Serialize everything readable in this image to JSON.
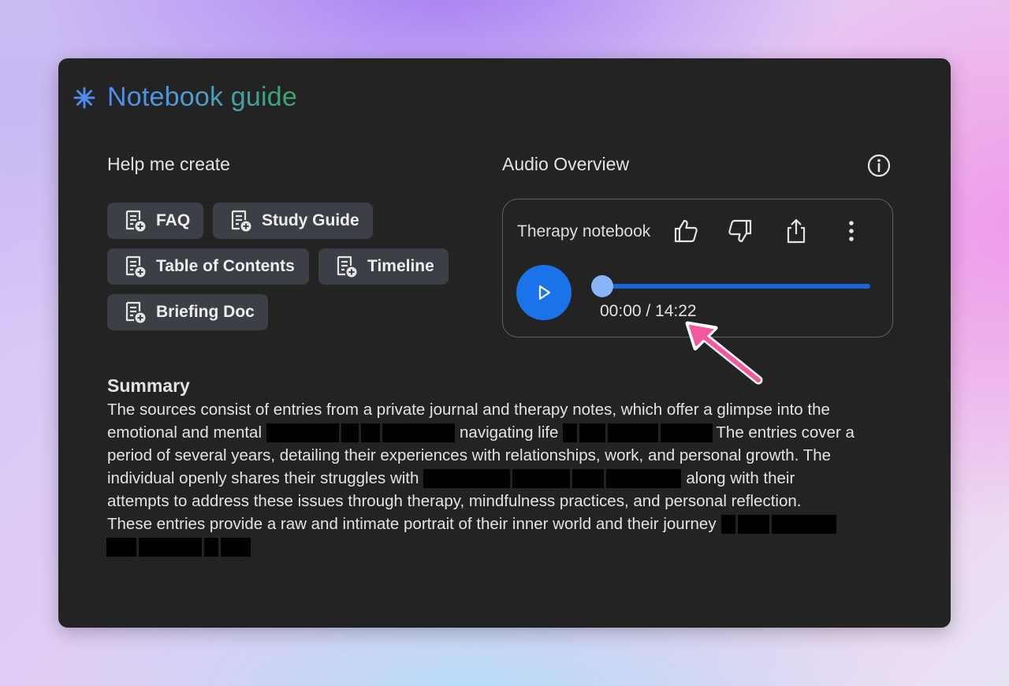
{
  "guide": {
    "title": "Notebook guide",
    "icon": "sparkle-asterisk-icon"
  },
  "help": {
    "heading": "Help me create",
    "chips": [
      {
        "label": "FAQ",
        "icon": "doc-add-icon"
      },
      {
        "label": "Study Guide",
        "icon": "doc-add-icon"
      },
      {
        "label": "Table of Contents",
        "icon": "doc-add-icon"
      },
      {
        "label": "Timeline",
        "icon": "doc-add-icon"
      },
      {
        "label": "Briefing Doc",
        "icon": "doc-add-icon"
      }
    ]
  },
  "audio": {
    "heading": "Audio Overview",
    "notebook_name": "Therapy notebook",
    "current_time": "00:00",
    "total_time": "14:22",
    "time_display": "00:00 / 14:22",
    "progress": 0,
    "actions": [
      "thumbs-up-icon",
      "thumbs-down-icon",
      "share-icon",
      "more-vert-icon"
    ]
  },
  "summary": {
    "heading": "Summary",
    "lines": [
      "The sources consist of entries from a private journal and therapy notes, which offer a glimpse into the",
      "emotional and mental",
      "navigating life",
      "The entries cover a",
      "period of several years, detailing their experiences with relationships, work, and personal growth. The",
      "individual openly shares their struggles with",
      "along with their",
      "attempts to address these issues through therapy, mindfulness practices, and personal reflection.",
      "These entries provide a raw and intimate portrait of their inner world and their journey"
    ]
  },
  "colors": {
    "card_bg": "#232323",
    "chip_bg": "#3c3f45",
    "accent_blue": "#1a73e8",
    "slider_thumb": "#8ab4f8",
    "annotation_arrow": "#f2589b"
  }
}
